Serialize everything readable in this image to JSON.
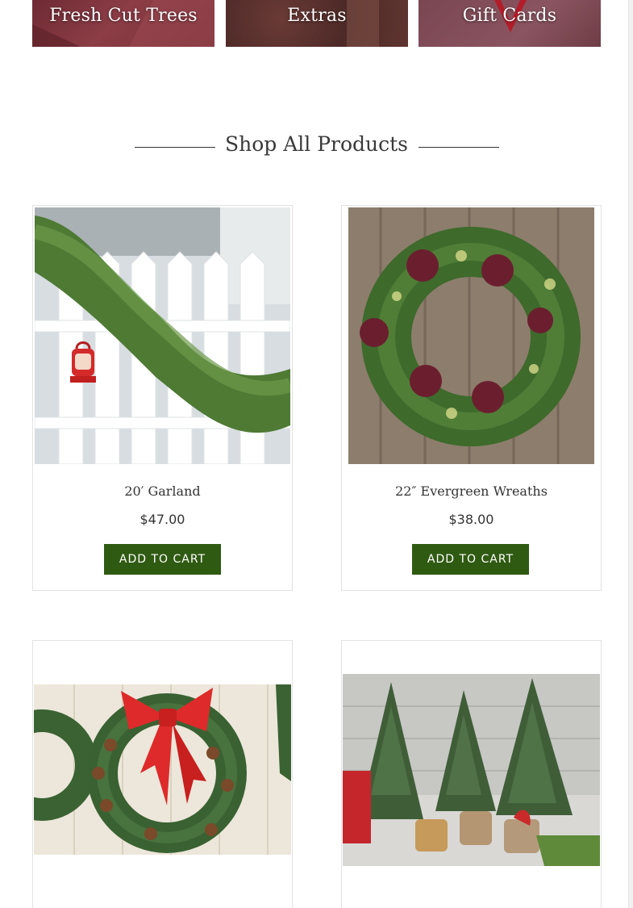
{
  "categories": [
    {
      "label": "Fresh Cut Trees"
    },
    {
      "label": "Extras"
    },
    {
      "label": "Gift Cards"
    }
  ],
  "section": {
    "title": "Shop All Products"
  },
  "products": [
    {
      "name": "20′ Garland",
      "price": "$47.00",
      "button": "ADD TO CART",
      "image_desc": "garland-on-white-fence-with-lantern"
    },
    {
      "name": "22″ Evergreen Wreaths",
      "price": "$38.00",
      "button": "ADD TO CART",
      "image_desc": "evergreen-wreath-with-red-flowers-on-wood"
    },
    {
      "name": "",
      "price": "",
      "button": "",
      "image_desc": "wreath-with-red-bow-and-pinecones"
    },
    {
      "name": "",
      "price": "",
      "button": "",
      "image_desc": "potted-small-trees"
    }
  ],
  "colors": {
    "button": "#2f5a12",
    "title_text": "#3a3a3a",
    "card_border": "#e2e2e2"
  }
}
